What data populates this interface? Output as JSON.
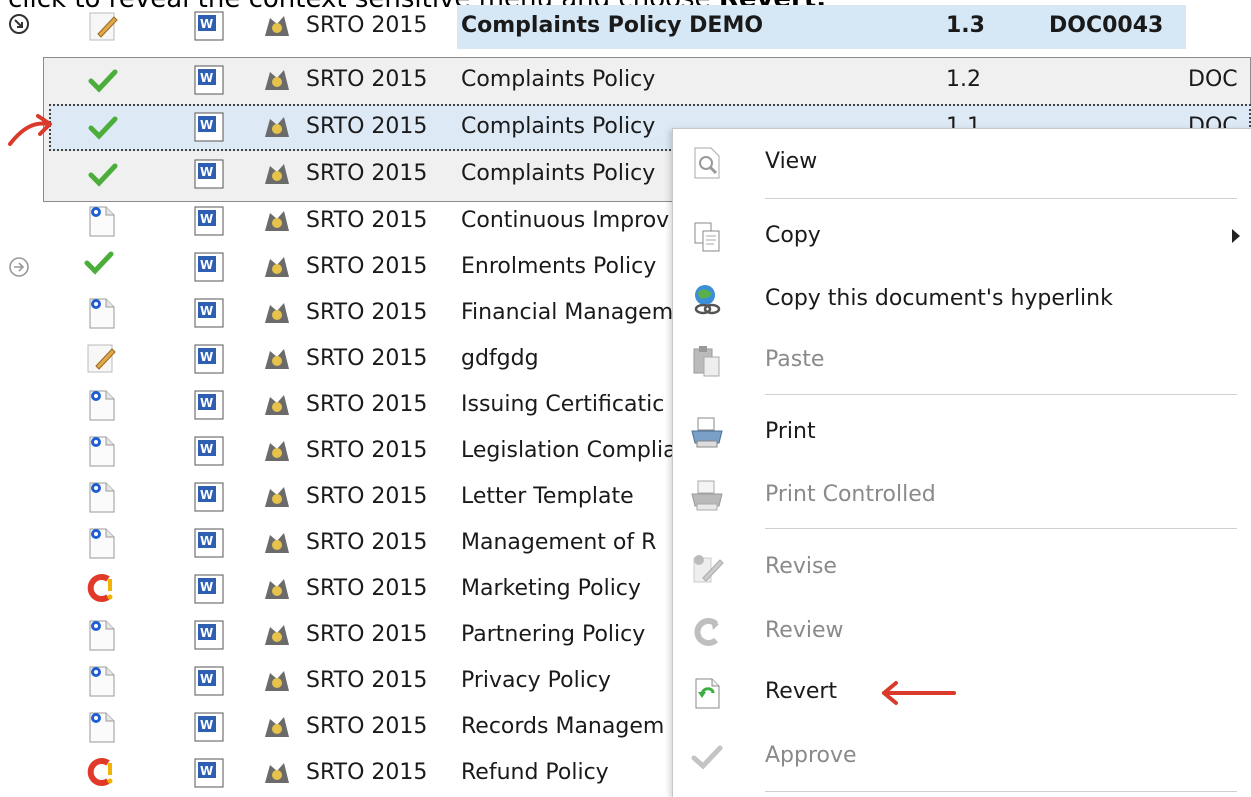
{
  "caption": {
    "prefix": "click to reveal the context sensitive menu and choose ",
    "emphasis": "Revert."
  },
  "folder_label": "SRTO 2015",
  "demo_row": {
    "title": "Complaints Policy DEMO",
    "version": "1.3",
    "code": "DOC0043"
  },
  "history_rows": [
    {
      "title": "Complaints Policy",
      "version": "1.2",
      "code": "DOC"
    },
    {
      "title": "Complaints Policy",
      "version": "1.1",
      "code": "DOC"
    },
    {
      "title": "Complaints Policy",
      "version": "",
      "code": ""
    }
  ],
  "rows": [
    {
      "title": "Continuous Improv",
      "status": "draft-blue-icon"
    },
    {
      "title": "Enrolments Policy",
      "status": "approved-check-icon"
    },
    {
      "title": "Financial Managem",
      "status": "draft-blue-icon"
    },
    {
      "title": "gdfgdg",
      "status": "edit-pencil-icon"
    },
    {
      "title": "Issuing Certificatic",
      "status": "draft-blue-icon"
    },
    {
      "title": "Legislation Complia",
      "status": "draft-blue-icon"
    },
    {
      "title": "Letter Template",
      "status": "draft-blue-icon"
    },
    {
      "title": "Management of R",
      "status": "draft-blue-icon"
    },
    {
      "title": "Marketing Policy",
      "status": "review-warning-icon"
    },
    {
      "title": "Partnering Policy",
      "status": "draft-blue-icon"
    },
    {
      "title": "Privacy Policy",
      "status": "draft-blue-icon"
    },
    {
      "title": "Records Managem",
      "status": "draft-blue-icon"
    },
    {
      "title": "Refund Policy",
      "status": "review-warning-icon"
    }
  ],
  "context_menu": {
    "items": [
      {
        "label": "View",
        "icon": "view-icon",
        "enabled": true
      },
      {
        "label": "Copy",
        "icon": "copy-icon",
        "enabled": true,
        "submenu": true
      },
      {
        "label": "Copy this document's hyperlink",
        "icon": "hyperlink-icon",
        "enabled": true
      },
      {
        "label": "Paste",
        "icon": "paste-icon",
        "enabled": false
      },
      {
        "label": "Print",
        "icon": "print-icon",
        "enabled": true
      },
      {
        "label": "Print Controlled",
        "icon": "print-controlled-icon",
        "enabled": false
      },
      {
        "label": "Revise",
        "icon": "revise-icon",
        "enabled": false
      },
      {
        "label": "Review",
        "icon": "review-icon",
        "enabled": false
      },
      {
        "label": "Revert",
        "icon": "revert-icon",
        "enabled": true
      },
      {
        "label": "Approve",
        "icon": "approve-icon",
        "enabled": false
      }
    ]
  },
  "colors": {
    "arrow_annotation": "#d93a2b",
    "selection": "#dde9f5",
    "highlight": "#d6e7f5"
  }
}
